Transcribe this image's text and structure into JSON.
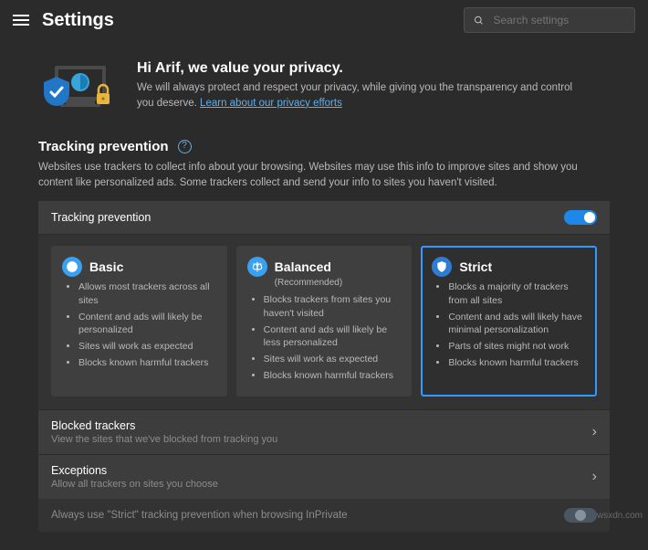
{
  "header": {
    "title": "Settings",
    "search_placeholder": "Search settings"
  },
  "hero": {
    "heading": "Hi Arif, we value your privacy.",
    "body_before_link": "We will always protect and respect your privacy, while giving you the transparency and control you deserve. ",
    "link_text": "Learn about our privacy efforts"
  },
  "section": {
    "title": "Tracking prevention",
    "desc": "Websites use trackers to collect info about your browsing. Websites may use this info to improve sites and show you content like personalized ads. Some trackers collect and send your info to sites you haven't visited."
  },
  "tracking": {
    "toggle_label": "Tracking prevention",
    "toggle_on": true,
    "levels": [
      {
        "name": "Basic",
        "subtitle": "",
        "icon_color": "#3aa0f0",
        "selected": false,
        "bullets": [
          "Allows most trackers across all sites",
          "Content and ads will likely be personalized",
          "Sites will work as expected",
          "Blocks known harmful trackers"
        ]
      },
      {
        "name": "Balanced",
        "subtitle": "(Recommended)",
        "icon_color": "#3aa0f0",
        "selected": false,
        "bullets": [
          "Blocks trackers from sites you haven't visited",
          "Content and ads will likely be less personalized",
          "Sites will work as expected",
          "Blocks known harmful trackers"
        ]
      },
      {
        "name": "Strict",
        "subtitle": "",
        "icon_color": "#2f7dd3",
        "selected": true,
        "bullets": [
          "Blocks a majority of trackers from all sites",
          "Content and ads will likely have minimal personalization",
          "Parts of sites might not work",
          "Blocks known harmful trackers"
        ]
      }
    ],
    "rows": [
      {
        "label": "Blocked trackers",
        "sub": "View the sites that we've blocked from tracking you"
      },
      {
        "label": "Exceptions",
        "sub": "Allow all trackers on sites you choose"
      }
    ],
    "inprivate_label": "Always use \"Strict\" tracking prevention when browsing InPrivate"
  },
  "watermark": "wsxdn.com"
}
